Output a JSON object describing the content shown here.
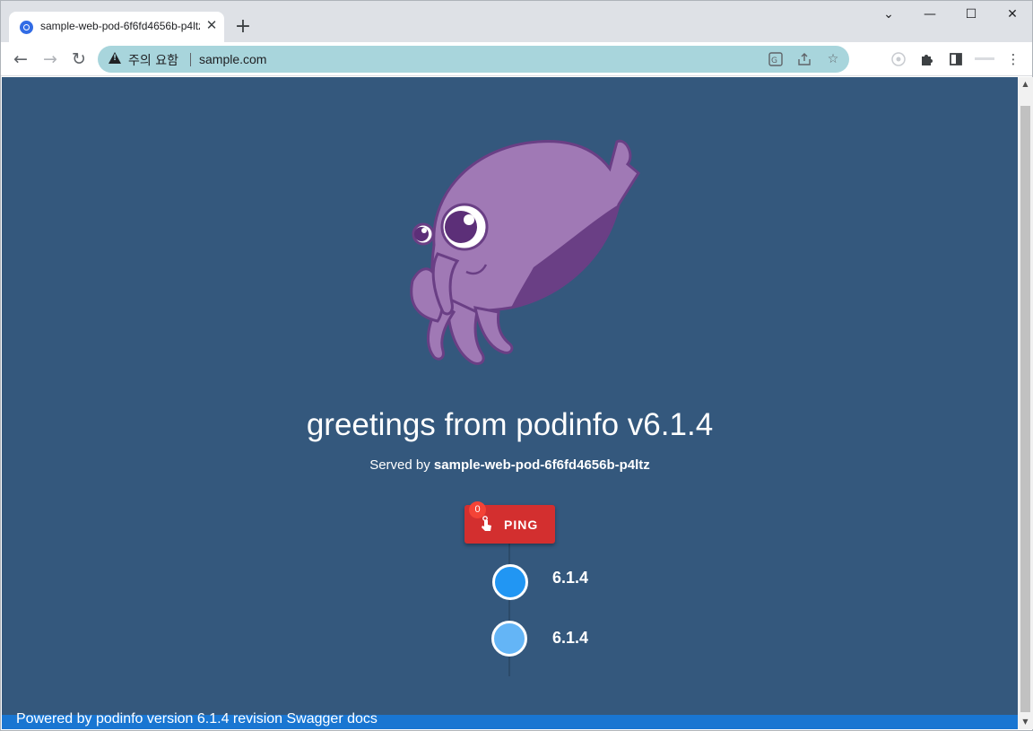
{
  "browser": {
    "tab_title": "sample-web-pod-6f6fd4656b-p4ltz",
    "tab_close": "✕",
    "new_tab": "+",
    "security_label": "주의 요함",
    "url": "sample.com",
    "window_controls": {
      "minimize": "—",
      "maximize": "☐",
      "close": "✕",
      "tab_search": "⌄"
    },
    "nav": {
      "back": "←",
      "forward": "→",
      "reload": "↻"
    },
    "toolbar_icons": [
      "translate-icon",
      "share-icon",
      "star-icon",
      "extension-i-icon",
      "extension-k8s-icon",
      "puzzle-icon",
      "side-panel-icon",
      "profile-avatar",
      "menu-icon"
    ]
  },
  "page": {
    "background": "#34587d",
    "greeting": "greetings from podinfo v6.1.4",
    "served_prefix": "Served by ",
    "served_host": "sample-web-pod-6f6fd4656b-p4ltz",
    "ping": {
      "label": "PING",
      "count": "0",
      "color": "#d32f2f"
    },
    "timeline": [
      {
        "version": "6.1.4",
        "color": "#2196f3"
      },
      {
        "version": "6.1.4",
        "color": "#64b5f6"
      }
    ],
    "footer": "Powered by podinfo version 6.1.4 revision Swagger docs",
    "footer_color": "#1976d2"
  }
}
